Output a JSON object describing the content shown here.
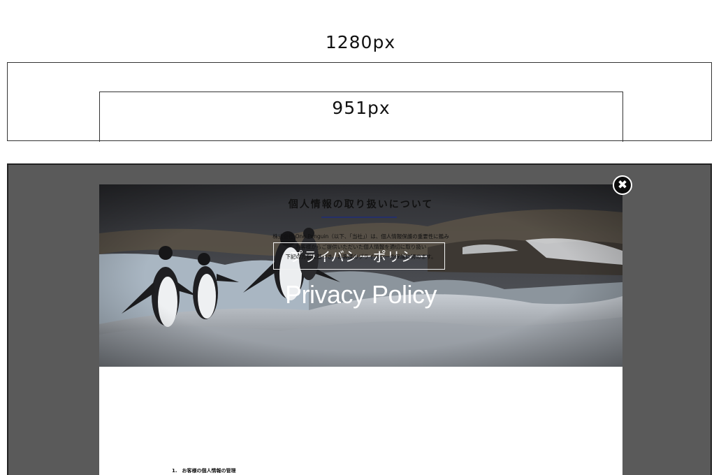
{
  "dimensions": {
    "outer_width_label": "1280px",
    "inner_width_label": "951px"
  },
  "modal": {
    "close_glyph": "✖",
    "hero": {
      "title_jp": "プライバシーポリシー",
      "title_en": "Privacy Policy"
    },
    "section_title": "個人情報の取り扱いについて",
    "intro_lines": [
      "株式会社 One Penguin（以下、「当社」）は、個人情報保護の重要性に鑑み",
      "お客様からご提供いただいた個人情報を適切に取り扱い",
      "下記の方針に基づき、お客様のプライバシーの保護に努めます。"
    ],
    "first_item": "1.　お客様の個人情報の管理"
  },
  "colors": {
    "overlay": "#5a5a5a",
    "rule_accent": "#24306a",
    "close_button": "#0c0c0c"
  },
  "icons": {
    "close": "close-icon"
  }
}
